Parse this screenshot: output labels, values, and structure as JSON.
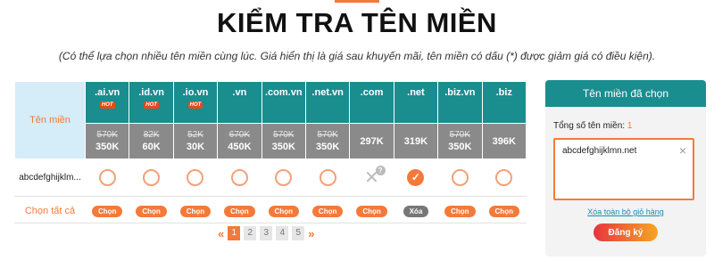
{
  "page": {
    "title": "KIỂM TRA TÊN MIỀN",
    "subtitle": "(Có thể lựa chọn nhiều tên miền cùng lúc. Giá hiển thị là giá sau khuyến mãi, tên miền có dấu (*) được giảm giá có điều kiện)."
  },
  "table": {
    "label_header": "Tên miền",
    "hot_label": "HOT",
    "extensions": [
      {
        "ext": ".ai.vn",
        "hot": true,
        "old_price": "570K",
        "price": "350K",
        "status": "available",
        "button": "Chọn"
      },
      {
        "ext": ".id.vn",
        "hot": true,
        "old_price": "82K",
        "price": "60K",
        "status": "available",
        "button": "Chọn"
      },
      {
        "ext": ".io.vn",
        "hot": true,
        "old_price": "52K",
        "price": "30K",
        "status": "available",
        "button": "Chọn"
      },
      {
        "ext": ".vn",
        "hot": false,
        "old_price": "670K",
        "price": "450K",
        "status": "available",
        "button": "Chọn"
      },
      {
        "ext": ".com.vn",
        "hot": false,
        "old_price": "570K",
        "price": "350K",
        "status": "available",
        "button": "Chọn"
      },
      {
        "ext": ".net.vn",
        "hot": false,
        "old_price": "570K",
        "price": "350K",
        "status": "available",
        "button": "Chọn"
      },
      {
        "ext": ".com",
        "hot": false,
        "old_price": "",
        "price": "297K",
        "status": "taken",
        "button": "Chọn"
      },
      {
        "ext": ".net",
        "hot": false,
        "old_price": "",
        "price": "319K",
        "status": "selected",
        "button": "Xóa"
      },
      {
        "ext": ".biz.vn",
        "hot": false,
        "old_price": "570K",
        "price": "350K",
        "status": "available",
        "button": "Chọn"
      },
      {
        "ext": ".biz",
        "hot": false,
        "old_price": "",
        "price": "396K",
        "status": "available",
        "button": "Chọn"
      }
    ],
    "domain_name": "abcdefghijklm...",
    "select_all": "Chọn tất cả"
  },
  "pagination": {
    "prev": "«",
    "next": "»",
    "pages": [
      "1",
      "2",
      "3",
      "4",
      "5"
    ],
    "current": "1"
  },
  "panel": {
    "title": "Tên miền đã chọn",
    "count_label": "Tổng số tên miền:",
    "count": "1",
    "selected_items": [
      "abcdefghijklmn.net"
    ],
    "remove_icon": "×",
    "clear_link": "Xóa toàn bộ giỏ hàng",
    "register_button": "Đăng ký"
  },
  "colors": {
    "accent": "#f47a3a",
    "teal": "#1a8d8f",
    "price_bg": "#8a8a8a",
    "label_bg": "#d5ecf9"
  }
}
